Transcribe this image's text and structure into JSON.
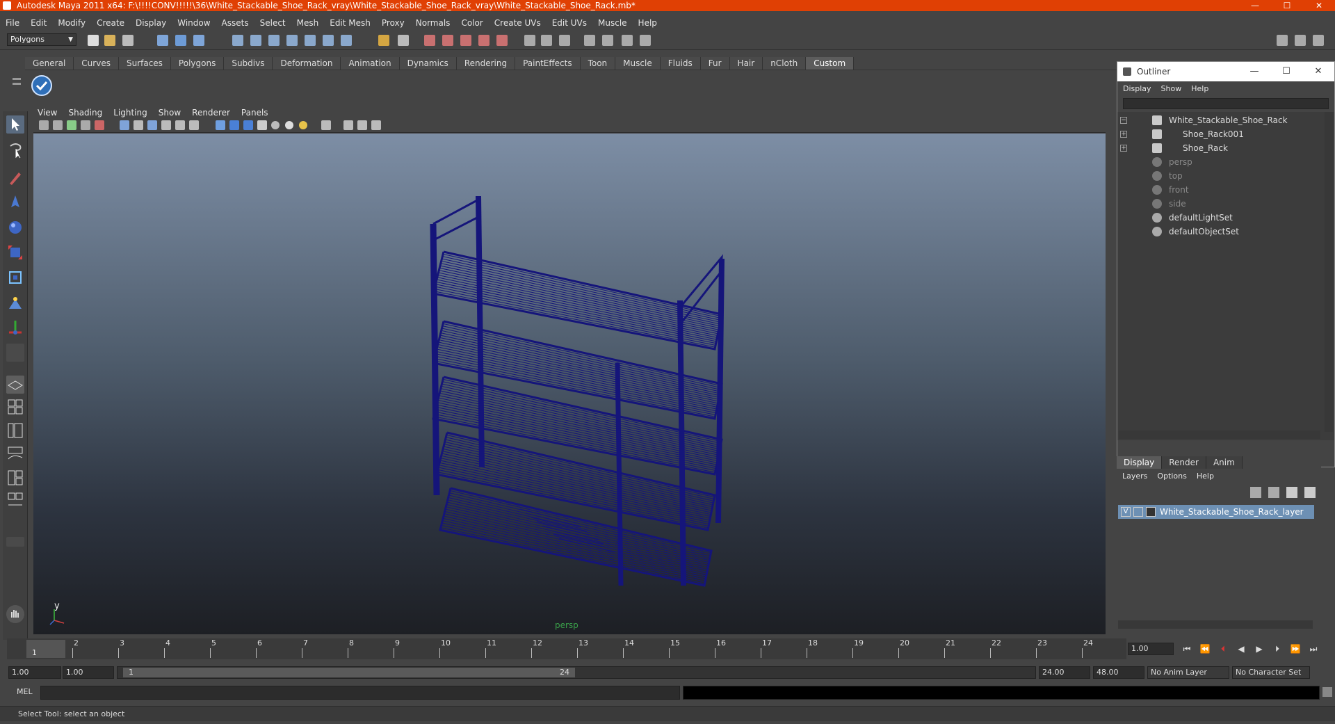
{
  "window": {
    "title": "Autodesk Maya 2011 x64: F:\\!!!!CONV!!!!!\\36\\White_Stackable_Shoe_Rack_vray\\White_Stackable_Shoe_Rack_vray\\White_Stackable_Shoe_Rack.mb*",
    "controls": [
      "—",
      "☐",
      "✕"
    ]
  },
  "menubar": [
    "File",
    "Edit",
    "Modify",
    "Create",
    "Display",
    "Window",
    "Assets",
    "Select",
    "Mesh",
    "Edit Mesh",
    "Proxy",
    "Normals",
    "Color",
    "Create UVs",
    "Edit UVs",
    "Muscle",
    "Help"
  ],
  "statusline": {
    "mode": "Polygons"
  },
  "shelf": {
    "tabs": [
      "General",
      "Curves",
      "Surfaces",
      "Polygons",
      "Subdivs",
      "Deformation",
      "Animation",
      "Dynamics",
      "Rendering",
      "PaintEffects",
      "Toon",
      "Muscle",
      "Fluids",
      "Fur",
      "Hair",
      "nCloth",
      "Custom"
    ],
    "active": "Custom"
  },
  "viewport": {
    "menu": [
      "View",
      "Shading",
      "Lighting",
      "Show",
      "Renderer",
      "Panels"
    ],
    "camera_label": "persp",
    "axis": {
      "y": "y",
      "x": "x"
    },
    "wire_color": "#15157a"
  },
  "outliner": {
    "title": "Outliner",
    "controls": [
      "—",
      "☐",
      "✕"
    ],
    "menu": [
      "Display",
      "Show",
      "Help"
    ],
    "items": [
      {
        "label": "White_Stackable_Shoe_Rack",
        "expander": "−",
        "dim": false
      },
      {
        "label": "Shoe_Rack001",
        "expander": "+",
        "dim": false
      },
      {
        "label": "Shoe_Rack",
        "expander": "+",
        "dim": false
      },
      {
        "label": "persp",
        "expander": "",
        "dim": true
      },
      {
        "label": "top",
        "expander": "",
        "dim": true
      },
      {
        "label": "front",
        "expander": "",
        "dim": true
      },
      {
        "label": "side",
        "expander": "",
        "dim": true
      },
      {
        "label": "defaultLightSet",
        "expander": "",
        "dim": false
      },
      {
        "label": "defaultObjectSet",
        "expander": "",
        "dim": false
      }
    ]
  },
  "layers": {
    "tabs": [
      "Display",
      "Render",
      "Anim"
    ],
    "active": "Display",
    "menu": [
      "Layers",
      "Options",
      "Help"
    ],
    "layer": {
      "visible": "V",
      "name": "White_Stackable_Shoe_Rack_layer"
    }
  },
  "timeline": {
    "ticks": [
      "1",
      "2",
      "3",
      "4",
      "5",
      "6",
      "7",
      "8",
      "9",
      "10",
      "11",
      "12",
      "13",
      "14",
      "15",
      "16",
      "17",
      "18",
      "19",
      "20",
      "21",
      "22",
      "23",
      "24"
    ],
    "current_frame": "1",
    "current_time": "1.00"
  },
  "range": {
    "start": "1.00",
    "inner_start": "1.00",
    "slider_start": "1",
    "slider_end": "24",
    "inner_end": "24.00",
    "end": "48.00",
    "anim_layer": "No Anim Layer",
    "character_set": "No Character Set"
  },
  "command": {
    "label": "MEL"
  },
  "helpline": "Select Tool: select an object"
}
